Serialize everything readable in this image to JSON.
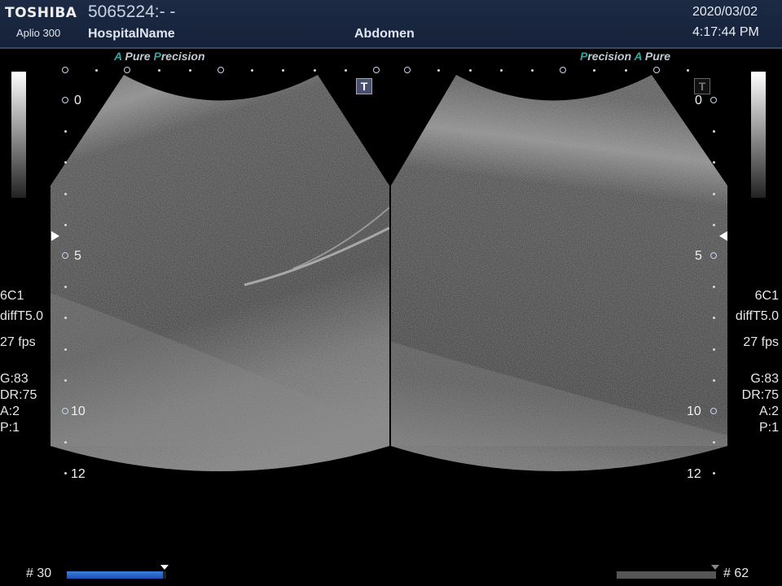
{
  "header": {
    "brand": "TOSHIBA",
    "model": "Aplio 300",
    "patient_id": "5065224:- -",
    "hospital": "HospitalName",
    "preset": "Abdomen",
    "date": "2020/03/02",
    "time": "4:17:44 PM"
  },
  "left_panel": {
    "tag_a": "A",
    "tag_pure": "Pure",
    "tag_p": "P",
    "tag_precision": "recision",
    "depth_labels": [
      "0",
      "5",
      "10",
      "12"
    ],
    "params": {
      "probe": "6C1",
      "mode": "diffT5.0",
      "fps": "27 fps",
      "gain": "G:83",
      "dr": "DR:75",
      "a": "A:2",
      "p": "P:1"
    },
    "frame_label": "# 30",
    "frame_progress": 0.97
  },
  "right_panel": {
    "tag_p": "P",
    "tag_precision": "recision",
    "tag_a": "A",
    "tag_pure": "Pure",
    "depth_labels": [
      "0",
      "5",
      "10",
      "12"
    ],
    "params": {
      "probe": "6C1",
      "mode": "diffT5.0",
      "fps": "27 fps",
      "gain": "G:83",
      "dr": "DR:75",
      "a": "A:2",
      "p": "P:1"
    },
    "frame_label": "# 62",
    "frame_progress": 1.0
  },
  "icons": {
    "t_active": "T",
    "t_inactive": "T"
  }
}
